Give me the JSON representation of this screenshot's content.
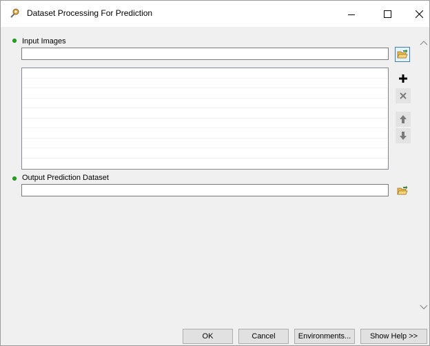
{
  "window": {
    "title": "Dataset Processing For Prediction",
    "icon": "tool-icon"
  },
  "params": {
    "input_images": {
      "label": "Input Images",
      "value": "",
      "list_items": []
    },
    "output_dataset": {
      "label": "Output Prediction Dataset",
      "value": ""
    }
  },
  "buttons": {
    "ok": "OK",
    "cancel": "Cancel",
    "environments": "Environments...",
    "show_help": "Show Help >>"
  },
  "colors": {
    "required_bullet": "#1fb01f",
    "accent": "#3c7fb1"
  }
}
